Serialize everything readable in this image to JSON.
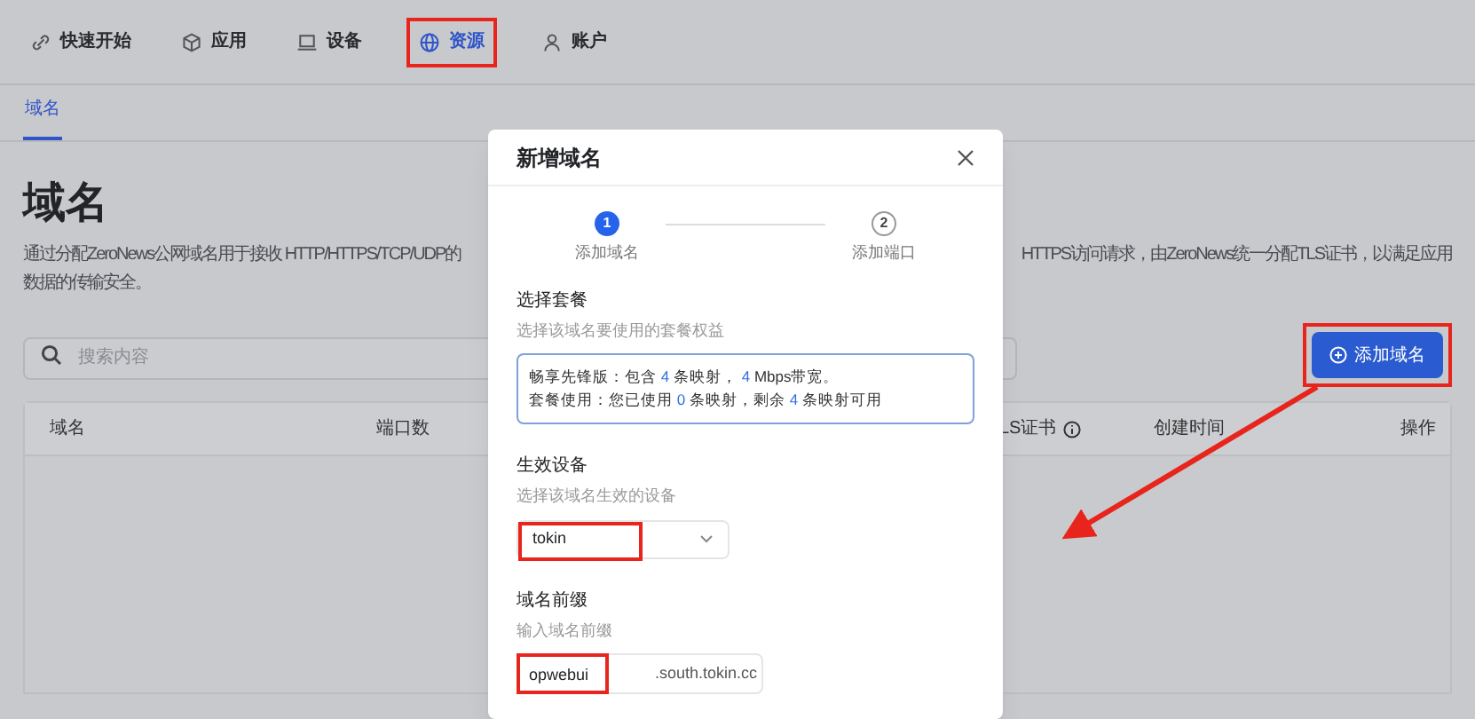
{
  "nav": [
    {
      "label": "快速开始",
      "selected": false,
      "highlighted": false
    },
    {
      "label": "应用",
      "selected": false,
      "highlighted": false
    },
    {
      "label": "设备",
      "selected": false,
      "highlighted": false
    },
    {
      "label": "资源",
      "selected": true,
      "highlighted": true
    },
    {
      "label": "账户",
      "selected": false,
      "highlighted": false
    }
  ],
  "sub_tabs": [
    {
      "label": "域名",
      "selected": true
    }
  ],
  "page": {
    "title": "域名",
    "description_left": [
      "通过分配ZeroNews公网域名用于接收 HTTP/HTTPS/TCP/UDP的",
      "数据的传输安全。"
    ],
    "description_right": "HTTPS访问请求，由ZeroNews统一分配TLS证书，以满足应用",
    "search": {
      "placeholder": "搜索内容"
    },
    "add_button": {
      "label": "添加域名",
      "highlighted": true
    },
    "table": {
      "columns_left": [
        "域名",
        "端口数"
      ],
      "columns_right": [
        {
          "label": "LS证书",
          "info": true
        },
        {
          "label": "创建时间",
          "info": false
        },
        {
          "label": "操作",
          "info": false
        }
      ]
    }
  },
  "modal": {
    "title": "新增域名",
    "steps": [
      {
        "number": "1",
        "label": "添加域名",
        "selected": true
      },
      {
        "number": "2",
        "label": "添加端口",
        "selected": false
      }
    ],
    "plan": {
      "label": "选择套餐",
      "hint": "选择该域名要使用的套餐权益",
      "lines": [
        [
          {
            "text": "畅享先锋版：包含 ",
            "highlight": false
          },
          {
            "text": "4",
            "highlight": true
          },
          {
            "text": " 条映射， ",
            "highlight": false
          },
          {
            "text": "4",
            "highlight": true
          },
          {
            "text": " Mbps带宽。",
            "highlight": false
          }
        ],
        [
          {
            "text": "套餐使用：您已使用 ",
            "highlight": false
          },
          {
            "text": "0",
            "highlight": true
          },
          {
            "text": " 条映射，剩余 ",
            "highlight": false
          },
          {
            "text": "4",
            "highlight": true
          },
          {
            "text": " 条映射可用",
            "highlight": false
          }
        ]
      ]
    },
    "device": {
      "label": "生效设备",
      "hint": "选择该域名生效的设备",
      "value": "tokin",
      "highlighted": true
    },
    "prefix": {
      "label": "域名前缀",
      "hint": "输入域名前缀",
      "value": "opwebui",
      "suffix": ".south.tokin.cc",
      "highlighted": true
    }
  }
}
